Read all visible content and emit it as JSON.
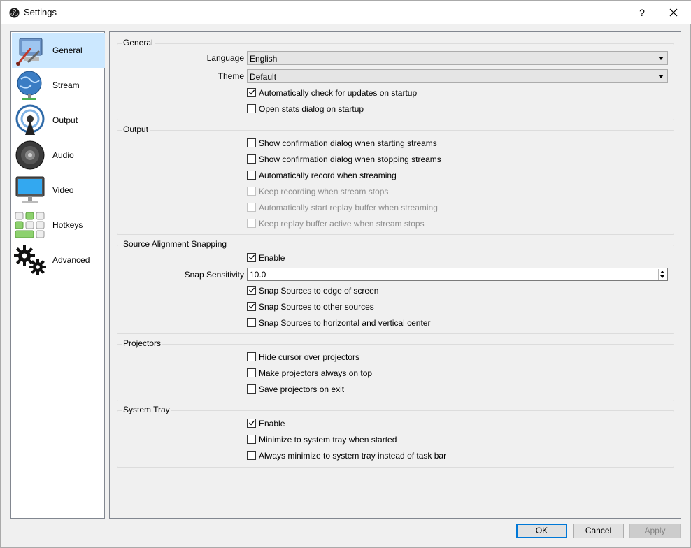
{
  "window": {
    "title": "Settings",
    "help": "?"
  },
  "sidebar": {
    "items": [
      {
        "label": "General",
        "icon": "general-icon",
        "selected": true
      },
      {
        "label": "Stream",
        "icon": "stream-icon",
        "selected": false
      },
      {
        "label": "Output",
        "icon": "output-icon",
        "selected": false
      },
      {
        "label": "Audio",
        "icon": "audio-icon",
        "selected": false
      },
      {
        "label": "Video",
        "icon": "video-icon",
        "selected": false
      },
      {
        "label": "Hotkeys",
        "icon": "hotkeys-icon",
        "selected": false
      },
      {
        "label": "Advanced",
        "icon": "advanced-icon",
        "selected": false
      }
    ]
  },
  "general": {
    "title": "General",
    "language_label": "Language",
    "language_value": "English",
    "theme_label": "Theme",
    "theme_value": "Default",
    "check_updates": {
      "label": "Automatically check for updates on startup",
      "checked": true
    },
    "open_stats": {
      "label": "Open stats dialog on startup",
      "checked": false
    }
  },
  "output": {
    "title": "Output",
    "options": [
      {
        "label": "Show confirmation dialog when starting streams",
        "checked": false,
        "enabled": true
      },
      {
        "label": "Show confirmation dialog when stopping streams",
        "checked": false,
        "enabled": true
      },
      {
        "label": "Automatically record when streaming",
        "checked": false,
        "enabled": true
      },
      {
        "label": "Keep recording when stream stops",
        "checked": false,
        "enabled": false
      },
      {
        "label": "Automatically start replay buffer when streaming",
        "checked": false,
        "enabled": false
      },
      {
        "label": "Keep replay buffer active when stream stops",
        "checked": false,
        "enabled": false
      }
    ]
  },
  "snapping": {
    "title": "Source Alignment Snapping",
    "enable": {
      "label": "Enable",
      "checked": true
    },
    "sensitivity_label": "Snap Sensitivity",
    "sensitivity_value": "10.0",
    "edge": {
      "label": "Snap Sources to edge of screen",
      "checked": true
    },
    "other": {
      "label": "Snap Sources to other sources",
      "checked": true
    },
    "center": {
      "label": "Snap Sources to horizontal and vertical center",
      "checked": false
    }
  },
  "projectors": {
    "title": "Projectors",
    "options": [
      {
        "label": "Hide cursor over projectors",
        "checked": false
      },
      {
        "label": "Make projectors always on top",
        "checked": false
      },
      {
        "label": "Save projectors on exit",
        "checked": false
      }
    ]
  },
  "tray": {
    "title": "System Tray",
    "options": [
      {
        "label": "Enable",
        "checked": true
      },
      {
        "label": "Minimize to system tray when started",
        "checked": false
      },
      {
        "label": "Always minimize to system tray instead of task bar",
        "checked": false
      }
    ]
  },
  "buttons": {
    "ok": "OK",
    "cancel": "Cancel",
    "apply": "Apply"
  },
  "colors": {
    "selection": "#cce8ff",
    "default_button_border": "#0078d7",
    "disabled_text": "#8d8d8d"
  }
}
